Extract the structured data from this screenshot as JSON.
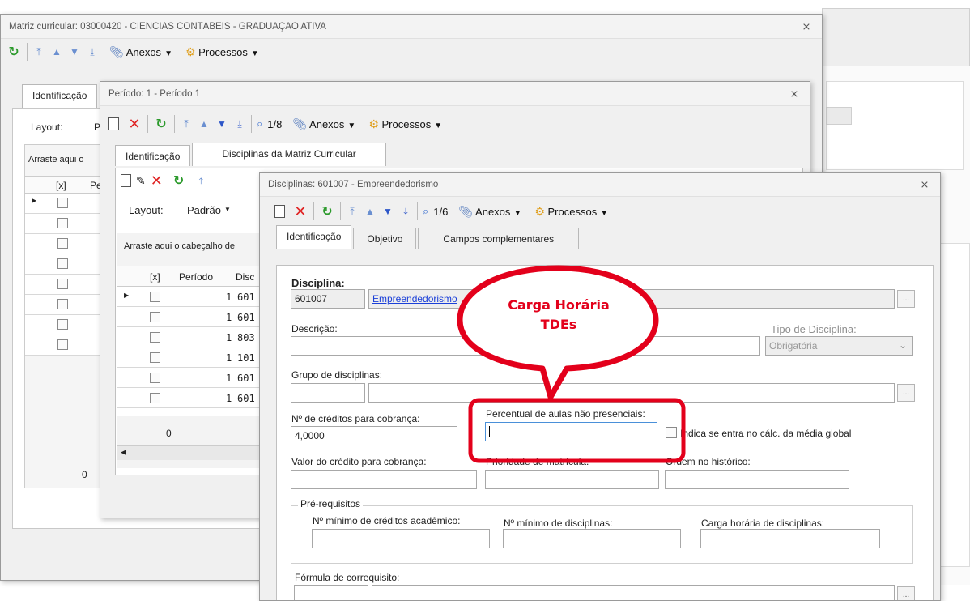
{
  "win1": {
    "title": "Matriz curricular: 03000420 - CIÊNCIAS CONTÁBEIS - GRADUAÇÃO ATIVA",
    "toolbar": {
      "anexos": "Anexos",
      "processos": "Processos"
    },
    "tab_identificacao": "Identificação",
    "layout_label": "Layout:",
    "layout_value": "P",
    "drag_hint": "Arraste aqui o",
    "col_x": "[x]",
    "col_pe": "Pe",
    "footer_count": "0"
  },
  "win2": {
    "title": "Período: 1 - Período 1",
    "counter": "1/8",
    "toolbar": {
      "anexos": "Anexos",
      "processos": "Processos"
    },
    "tabs": [
      "Identificação",
      "Disciplinas da Matriz Curricular"
    ],
    "layout_label": "Layout:",
    "layout_value": "Padrão",
    "drag_hint": "Arraste aqui o cabeçalho de",
    "columns": [
      "[x]",
      "Período",
      "Disc"
    ],
    "rows": [
      {
        "periodo": "1",
        "disc": "601"
      },
      {
        "periodo": "1",
        "disc": "601"
      },
      {
        "periodo": "1",
        "disc": "803"
      },
      {
        "periodo": "1",
        "disc": "101"
      },
      {
        "periodo": "1",
        "disc": "601"
      },
      {
        "periodo": "1",
        "disc": "601"
      }
    ],
    "footer_count": "0"
  },
  "win3": {
    "title": "Disciplinas: 601007 - Empreendedorismo",
    "counter": "1/6",
    "toolbar": {
      "anexos": "Anexos",
      "processos": "Processos"
    },
    "tabs": [
      "Identificação",
      "Objetivo",
      "Campos complementares"
    ],
    "disciplina_label": "Disciplina:",
    "disciplina_code": "601007",
    "disciplina_name": "Empreendedorismo",
    "descricao_label": "Descrição:",
    "tipo_label": "Tipo de Disciplina:",
    "tipo_value": "Obrigatória",
    "grupo_label": "Grupo de disciplinas:",
    "creditos_label": "Nº de créditos para cobrança:",
    "creditos_value": "4,0000",
    "percentual_label": "Percentual de aulas não presenciais:",
    "indica_label": "Indica se entra no cálc. da média global",
    "valor_label": "Valor do crédito para cobrança:",
    "prioridade_label": "Prioridade de matrícula:",
    "ordem_label": "Ordem no histórico:",
    "prereq_label": "Pré-requisitos",
    "min_creditos_label": "Nº mínimo de créditos acadêmico:",
    "min_disciplinas_label": "Nº mínimo de disciplinas:",
    "carga_label": "Carga horária de disciplinas:",
    "formula_label": "Fórmula de correquisito:",
    "ellipsis": "..."
  },
  "callout": {
    "line1": "Carga Horária",
    "line2": "TDEs",
    "color": "#e3001b"
  }
}
